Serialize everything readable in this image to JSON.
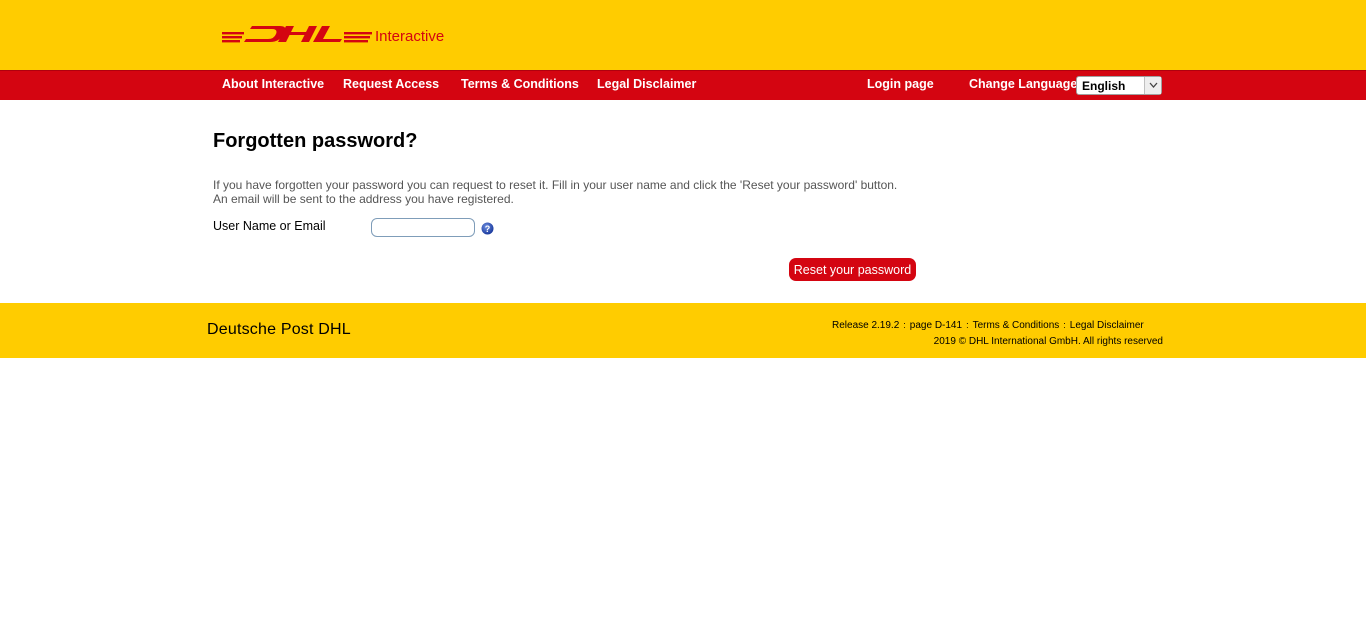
{
  "header": {
    "logo_alt": "DHL",
    "logo_sub": "Interactive"
  },
  "nav": {
    "items": [
      {
        "label": "About Interactive"
      },
      {
        "label": "Request Access"
      },
      {
        "label": "Terms & Conditions"
      },
      {
        "label": "Legal Disclaimer"
      }
    ],
    "login": "Login page",
    "language_label": "Change Language",
    "language_value": "English"
  },
  "main": {
    "title": "Forgotten password?",
    "intro_line1": "If you have forgotten your password you can request to reset it. Fill in your user name and click the 'Reset your password' button.",
    "intro_line2": "An email will be sent to the address you have registered.",
    "field_label": "User Name or Email",
    "field_value": "",
    "reset_button": "Reset your password"
  },
  "footer": {
    "brand": "Deutsche Post DHL",
    "release": "Release 2.19.2",
    "page": "page D-141",
    "terms": "Terms & Conditions",
    "disclaimer": "Legal Disclaimer",
    "copyright": "2019 © DHL International GmbH. All rights reserved"
  },
  "colors": {
    "brand_yellow": "#ffcc00",
    "brand_red": "#d40511"
  }
}
